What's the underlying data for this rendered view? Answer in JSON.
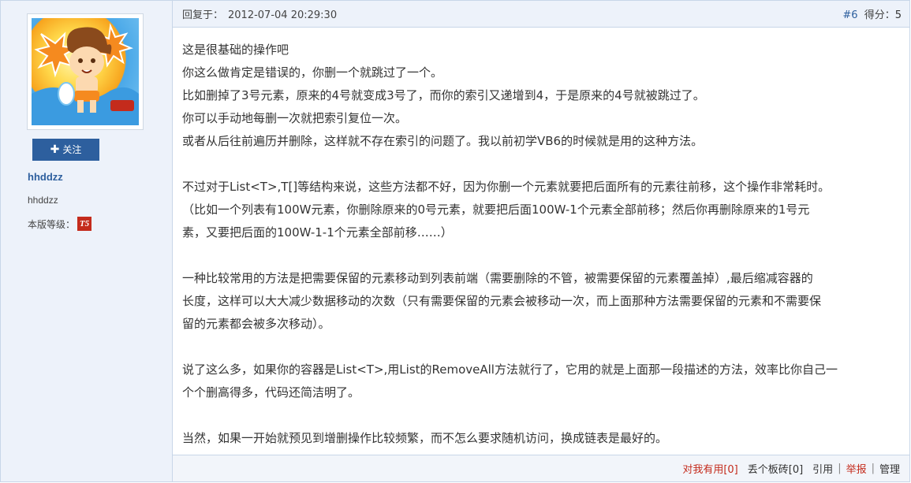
{
  "user": {
    "follow_label": "关注",
    "username": "hhddzz",
    "nickname": "hhddzz",
    "level_label": "本版等级：",
    "level_badge": "T5"
  },
  "post": {
    "reply_label": "回复于：",
    "timestamp": "2012-07-04 20:29:30",
    "floor": "#6",
    "score_label": "得分：",
    "score": "5",
    "paragraphs": [
      [
        "这是很基础的操作吧",
        "你这么做肯定是错误的，你删一个就跳过了一个。",
        "比如删掉了3号元素，原来的4号就变成3号了，而你的索引又递增到4，于是原来的4号就被跳过了。",
        "你可以手动地每删一次就把索引复位一次。",
        "或者从后往前遍历并删除，这样就不存在索引的问题了。我以前初学VB6的时候就是用的这种方法。"
      ],
      [
        "不过对于List<T>,T[]等结构来说，这些方法都不好，因为你删一个元素就要把后面所有的元素往前移，这个操作非常耗时。",
        "（比如一个列表有100W元素，你删除原来的0号元素，就要把后面100W-1个元素全部前移；然后你再删除原来的1号元",
        "素，又要把后面的100W-1-1个元素全部前移……）"
      ],
      [
        "一种比较常用的方法是把需要保留的元素移动到列表前端（需要删除的不管，被需要保留的元素覆盖掉）,最后缩减容器的",
        "长度，这样可以大大减少数据移动的次数（只有需要保留的元素会被移动一次，而上面那种方法需要保留的元素和不需要保",
        "留的元素都会被多次移动）。"
      ],
      [
        "说了这么多，如果你的容器是List<T>,用List的RemoveAll方法就行了，它用的就是上面那一段描述的方法，效率比你自己一",
        "个个删高得多，代码还简洁明了。"
      ],
      [
        "当然，如果一开始就预见到增删操作比较频繁，而不怎么要求随机访问，换成链表是最好的。"
      ]
    ]
  },
  "actions": {
    "useful": "对我有用[0]",
    "brick": "丢个板砖[0]",
    "quote": "引用",
    "report": "举报",
    "manage": "管理"
  }
}
